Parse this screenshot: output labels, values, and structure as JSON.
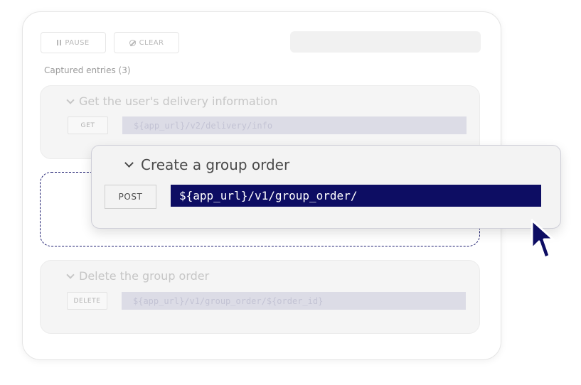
{
  "toolbar": {
    "pause_label": "PAUSE",
    "clear_label": "CLEAR",
    "pause_icon": "pause-icon",
    "clear_icon": "block-icon"
  },
  "captured_label": "Captured entries (3)",
  "entries": [
    {
      "title": "Get the user's delivery information",
      "method": "GET",
      "url": "${app_url}/v2/delivery/info"
    },
    {
      "title": "Create a group order",
      "method": "POST",
      "url": "${app_url}/v1/group_order/"
    },
    {
      "title": "Delete the group order",
      "method": "DELETE",
      "url": "${app_url}/v1/group_order/${order_id}"
    }
  ],
  "colors": {
    "accent": "#0d0d63",
    "dropzone_border": "#1b1b6e"
  }
}
